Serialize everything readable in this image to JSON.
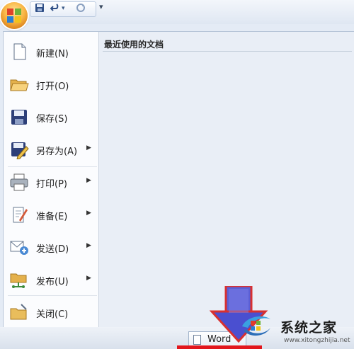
{
  "quick_access": {
    "save_icon": "save-icon",
    "undo_icon": "undo-icon",
    "redo_icon": "redo-icon",
    "customize_icon": "dropdown-arrow-icon"
  },
  "menu": {
    "items": [
      {
        "label": "新建(N)",
        "icon": "new-document-icon",
        "submenu": false
      },
      {
        "label": "打开(O)",
        "icon": "open-folder-icon",
        "submenu": false
      },
      {
        "label": "保存(S)",
        "icon": "save-disk-icon",
        "submenu": false
      },
      {
        "label": "另存为(A)",
        "icon": "save-as-icon",
        "submenu": true
      },
      {
        "label": "打印(P)",
        "icon": "printer-icon",
        "submenu": true
      },
      {
        "label": "准备(E)",
        "icon": "prepare-icon",
        "submenu": true
      },
      {
        "label": "发送(D)",
        "icon": "send-icon",
        "submenu": true
      },
      {
        "label": "发布(U)",
        "icon": "publish-icon",
        "submenu": true
      },
      {
        "label": "关闭(C)",
        "icon": "close-folder-icon",
        "submenu": false
      }
    ]
  },
  "recent": {
    "title": "最近使用的文档"
  },
  "taskbar": {
    "word_label": "Word"
  },
  "watermark": {
    "title": "系统之家",
    "url": "www.xitongzhijia.net"
  },
  "colors": {
    "highlight_bar": "#e2161c",
    "office_orange": "#f9b746",
    "arrow_blue": "#4a4fd0"
  }
}
